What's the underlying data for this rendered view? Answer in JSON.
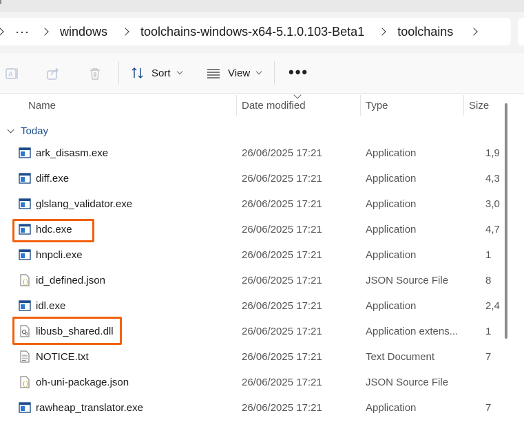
{
  "breadcrumb": {
    "overflow": "···",
    "items": [
      "windows",
      "toolchains-windows-x64-5.1.0.103-Beta1",
      "toolchains"
    ]
  },
  "toolbar": {
    "sort_label": "Sort",
    "view_label": "View",
    "more_label": "•••"
  },
  "columns": {
    "name": "Name",
    "date": "Date modified",
    "type": "Type",
    "size": "Size"
  },
  "group": {
    "label": "Today"
  },
  "files": [
    {
      "name": "ark_disasm.exe",
      "date": "26/06/2025 17:21",
      "type": "Application",
      "size": "1,9",
      "icon": "app-icon"
    },
    {
      "name": "diff.exe",
      "date": "26/06/2025 17:21",
      "type": "Application",
      "size": "4,3",
      "icon": "app-icon"
    },
    {
      "name": "glslang_validator.exe",
      "date": "26/06/2025 17:21",
      "type": "Application",
      "size": "3,0",
      "icon": "app-icon"
    },
    {
      "name": "hdc.exe",
      "date": "26/06/2025 17:21",
      "type": "Application",
      "size": "4,7",
      "icon": "app-icon"
    },
    {
      "name": "hnpcli.exe",
      "date": "26/06/2025 17:21",
      "type": "Application",
      "size": "1",
      "icon": "app-icon"
    },
    {
      "name": "id_defined.json",
      "date": "26/06/2025 17:21",
      "type": "JSON Source File",
      "size": "8",
      "icon": "json-icon"
    },
    {
      "name": "idl.exe",
      "date": "26/06/2025 17:21",
      "type": "Application",
      "size": "2,4",
      "icon": "app-icon"
    },
    {
      "name": "libusb_shared.dll",
      "date": "26/06/2025 17:21",
      "type": "Application extens...",
      "size": "1",
      "icon": "dll-icon"
    },
    {
      "name": "NOTICE.txt",
      "date": "26/06/2025 17:21",
      "type": "Text Document",
      "size": "7",
      "icon": "text-file-icon"
    },
    {
      "name": "oh-uni-package.json",
      "date": "26/06/2025 17:21",
      "type": "JSON Source File",
      "size": "",
      "icon": "json-icon"
    },
    {
      "name": "rawheap_translator.exe",
      "date": "26/06/2025 17:21",
      "type": "Application",
      "size": "7",
      "icon": "app-icon"
    }
  ],
  "colors": {
    "highlight": "#f2600c",
    "group_text": "#1e4f8c"
  }
}
